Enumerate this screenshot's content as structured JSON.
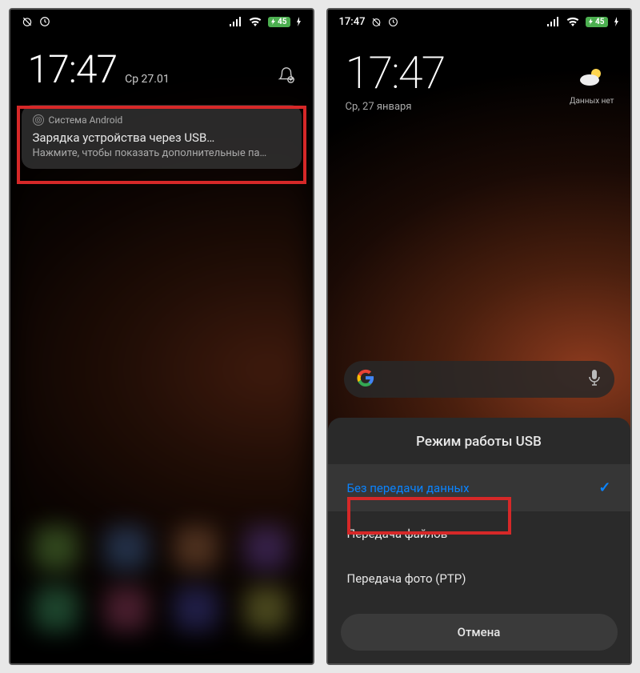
{
  "left": {
    "status": {
      "time": "",
      "battery": "45"
    },
    "clock": {
      "time": "17:47",
      "date": "Ср 27.01"
    },
    "notification": {
      "app": "Система Android",
      "title": "Зарядка устройства через USB…",
      "body": "Нажмите, чтобы показать дополнительные па…"
    }
  },
  "right": {
    "status": {
      "time": "17:47",
      "battery": "45"
    },
    "clock": {
      "time": "17:47",
      "date": "Ср, 27 января"
    },
    "weather": {
      "text": "Данных нет"
    },
    "dialog": {
      "title": "Режим работы USB",
      "options": [
        {
          "label": "Без передачи данных",
          "selected": true
        },
        {
          "label": "Передача файлов",
          "selected": false
        },
        {
          "label": "Передача фото (PTP)",
          "selected": false
        }
      ],
      "cancel": "Отмена"
    }
  }
}
